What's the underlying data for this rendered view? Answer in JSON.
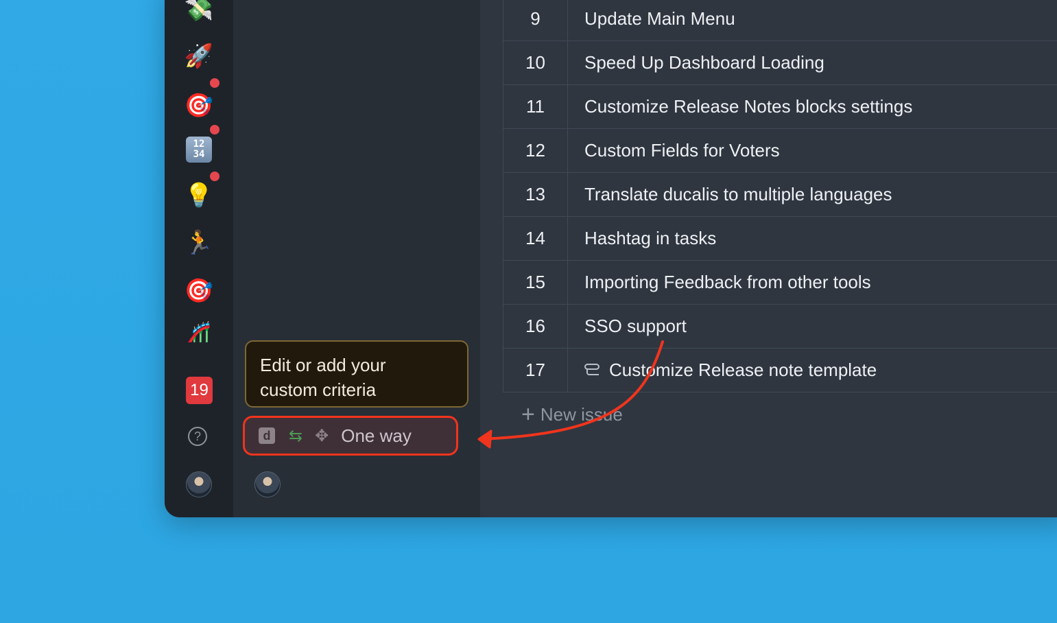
{
  "sidebar": {
    "icons": [
      {
        "name": "money-with-wings-icon",
        "glyph": "💸"
      },
      {
        "name": "rocket-icon",
        "glyph": "🚀"
      },
      {
        "name": "direct-hit-icon",
        "glyph": "🎯"
      },
      {
        "name": "numbers-icon",
        "glyph": "1234"
      },
      {
        "name": "light-bulb-icon",
        "glyph": "💡"
      },
      {
        "name": "runner-icon",
        "glyph": "🏃"
      },
      {
        "name": "direct-hit-icon",
        "glyph": "🎯"
      },
      {
        "name": "roller-coaster-icon",
        "glyph": "🎢"
      }
    ],
    "badge_count": "19",
    "help_glyph": "?"
  },
  "tooltip": {
    "text_line1": "Edit or add your",
    "text_line2": "custom criteria"
  },
  "sync_status": {
    "d_badge": "d",
    "arrows_glyph": "⇆",
    "jira_glyph": "✥",
    "label": "One way"
  },
  "issues": [
    {
      "num": "9",
      "title": "Update Main Menu"
    },
    {
      "num": "10",
      "title": "Speed Up Dashboard Loading"
    },
    {
      "num": "11",
      "title": "Customize Release Notes blocks settings"
    },
    {
      "num": "12",
      "title": "Custom Fields for Voters"
    },
    {
      "num": "13",
      "title": "Translate ducalis to multiple languages"
    },
    {
      "num": "14",
      "title": "Hashtag in tasks"
    },
    {
      "num": "15",
      "title": "Importing Feedback from other tools"
    },
    {
      "num": "16",
      "title": "SSO support"
    },
    {
      "num": "17",
      "title": "Customize Release note template",
      "icon": "template-icon"
    }
  ],
  "new_issue": {
    "plus": "+",
    "label": "New issue"
  },
  "colors": {
    "background": "#2ea8e4",
    "annotation": "#f1341d"
  }
}
